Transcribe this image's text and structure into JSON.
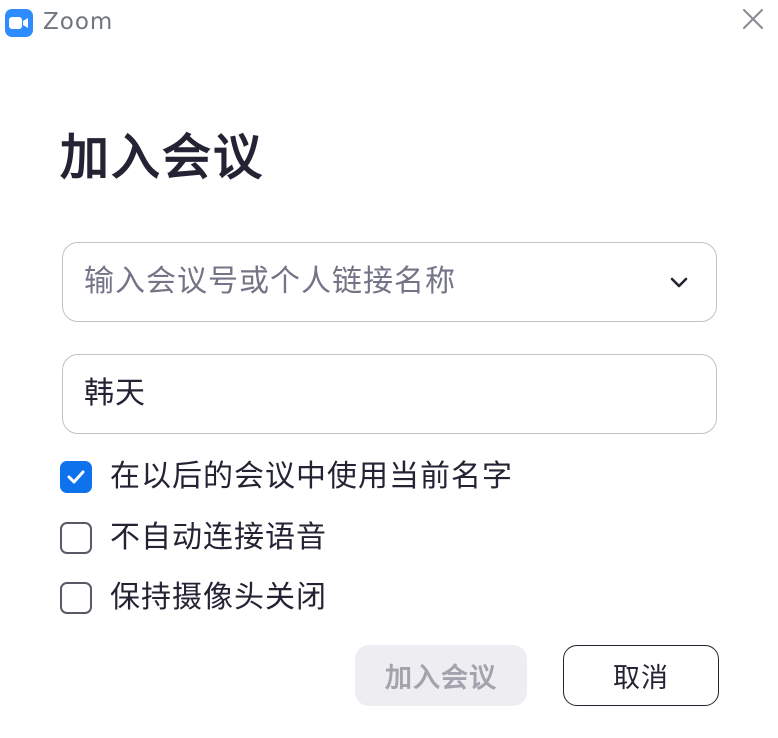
{
  "window": {
    "app_title": "Zoom"
  },
  "icons": {
    "app_logo": "zoom-camera-icon",
    "close": "close-icon",
    "dropdown": "chevron-down-icon",
    "checkmark": "checkmark-icon"
  },
  "colors": {
    "brand": "#2d8cff",
    "checkbox_checked": "#0e72ed",
    "text_primary": "#232333",
    "placeholder": "#747487",
    "disabled_button_bg": "#ededf2",
    "disabled_button_text": "#a3a3ad"
  },
  "page": {
    "title": "加入会议"
  },
  "meeting_id_field": {
    "placeholder": "输入会议号或个人链接名称",
    "value": ""
  },
  "name_field": {
    "value": "韩天"
  },
  "options": [
    {
      "label": "在以后的会议中使用当前名字",
      "checked": true
    },
    {
      "label": "不自动连接语音",
      "checked": false
    },
    {
      "label": "保持摄像头关闭",
      "checked": false
    }
  ],
  "buttons": {
    "join_label": "加入会议",
    "join_enabled": false,
    "cancel_label": "取消"
  }
}
